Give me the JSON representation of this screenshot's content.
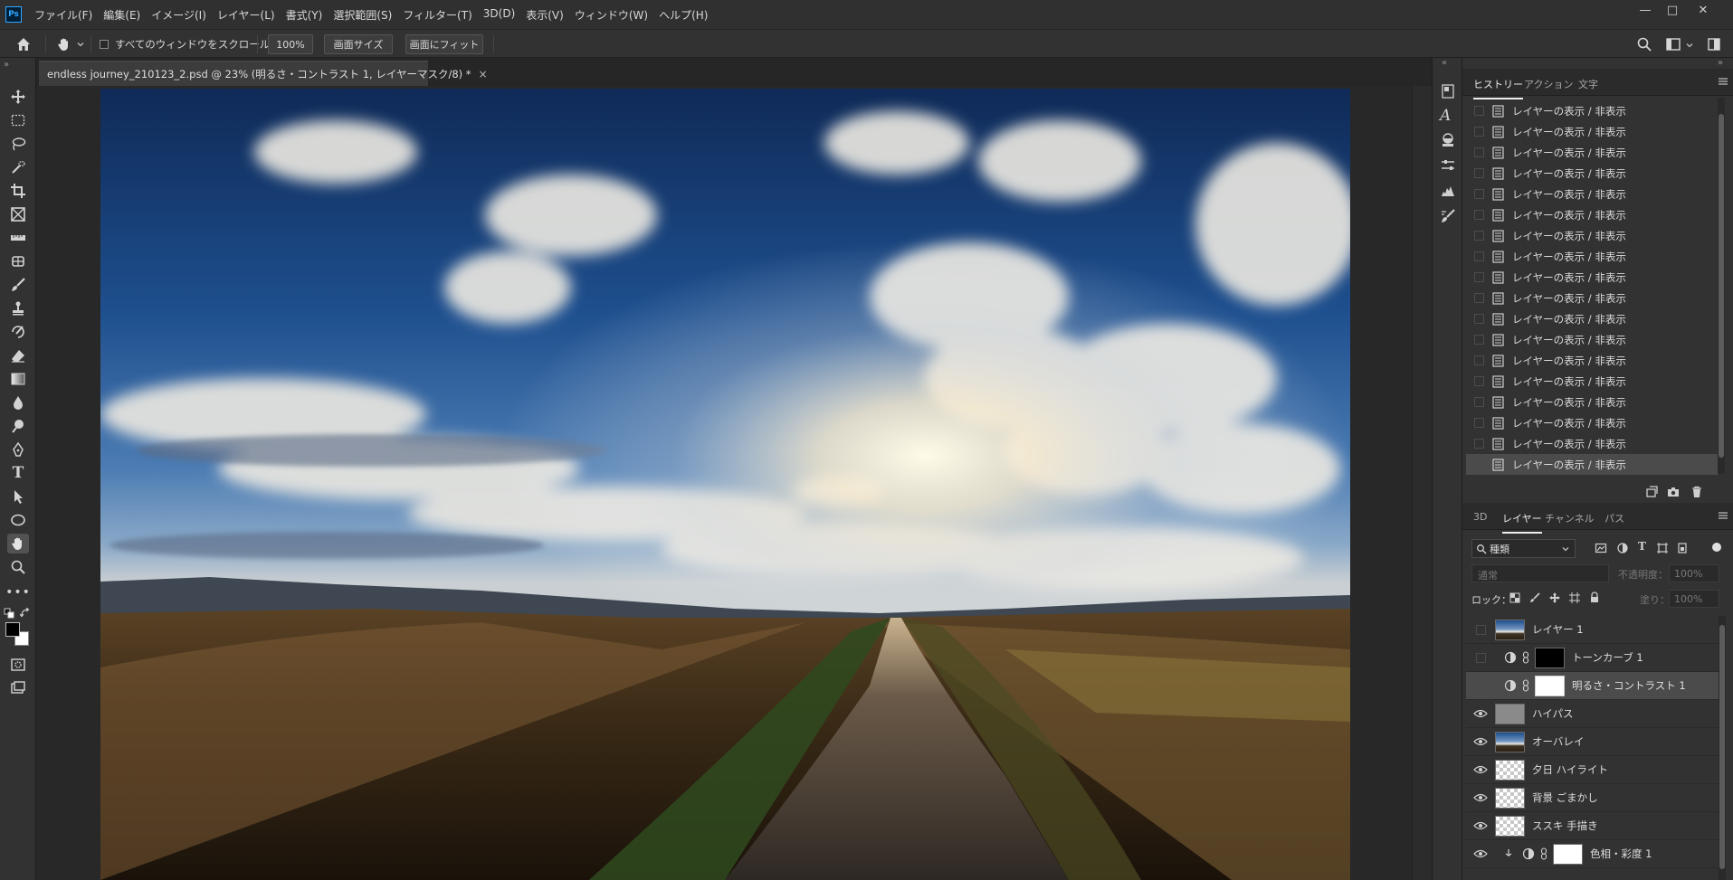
{
  "app": {
    "logo": "Ps"
  },
  "menu": [
    "ファイル(F)",
    "編集(E)",
    "イメージ(I)",
    "レイヤー(L)",
    "書式(Y)",
    "選択範囲(S)",
    "フィルター(T)",
    "3D(D)",
    "表示(V)",
    "ウィンドウ(W)",
    "ヘルプ(H)"
  ],
  "window_controls": {
    "minimize": "—",
    "maximize": "□",
    "close": "✕"
  },
  "options": {
    "scroll_all_label": "すべてのウィンドウをスクロール",
    "zoom_value": "100%",
    "fit_screen_size": "画面サイズ",
    "fit_screen": "画面にフィット"
  },
  "document": {
    "tab_title": "endless journey_210123_2.psd @ 23% (明るさ・コントラスト 1, レイヤーマスク/8) *",
    "close_glyph": "×"
  },
  "history_panel": {
    "tabs": [
      "ヒストリー",
      "アクション",
      "文字"
    ],
    "active_tab": 0,
    "items": [
      "レイヤーの表示 / 非表示",
      "レイヤーの表示 / 非表示",
      "レイヤーの表示 / 非表示",
      "レイヤーの表示 / 非表示",
      "レイヤーの表示 / 非表示",
      "レイヤーの表示 / 非表示",
      "レイヤーの表示 / 非表示",
      "レイヤーの表示 / 非表示",
      "レイヤーの表示 / 非表示",
      "レイヤーの表示 / 非表示",
      "レイヤーの表示 / 非表示",
      "レイヤーの表示 / 非表示",
      "レイヤーの表示 / 非表示",
      "レイヤーの表示 / 非表示",
      "レイヤーの表示 / 非表示",
      "レイヤーの表示 / 非表示",
      "レイヤーの表示 / 非表示",
      "レイヤーの表示 / 非表示"
    ]
  },
  "layers_panel": {
    "tabs": [
      "3D",
      "レイヤー",
      "チャンネル",
      "パス"
    ],
    "active_tab": 1,
    "filter_kind": "種類",
    "blend_mode": "通常",
    "opacity_label": "不透明度：",
    "opacity_value": "100%",
    "lock_label": "ロック：",
    "fill_label": "塗り：",
    "fill_value": "100%",
    "layers": [
      {
        "name": "レイヤー 1",
        "visible": false,
        "thumb": "photo",
        "adjustment": false,
        "mask": null
      },
      {
        "name": "トーンカーブ 1",
        "visible": false,
        "thumb": null,
        "adjustment": true,
        "mask": "black"
      },
      {
        "name": "明るさ・コントラスト 1",
        "visible": false,
        "thumb": null,
        "adjustment": true,
        "mask": "white",
        "selected": true
      },
      {
        "name": "ハイパス",
        "visible": true,
        "thumb": "gray",
        "adjustment": false,
        "mask": null
      },
      {
        "name": "オーバレイ",
        "visible": true,
        "thumb": "photo",
        "adjustment": false,
        "mask": null
      },
      {
        "name": "夕日 ハイライト",
        "visible": true,
        "thumb": "checker",
        "adjustment": false,
        "mask": null
      },
      {
        "name": "背景 ごまかし",
        "visible": true,
        "thumb": "checker",
        "adjustment": false,
        "mask": null
      },
      {
        "name": "ススキ 手描き",
        "visible": true,
        "thumb": "checker",
        "adjustment": false,
        "mask": null
      },
      {
        "name": "色相・彩度 1",
        "visible": true,
        "thumb": null,
        "adjustment": true,
        "mask": "white",
        "clipped": true
      }
    ]
  },
  "colors": {
    "accent": "#31a8ff",
    "panel_bg": "#323232",
    "canvas_bg": "#282828",
    "selection": "#4b4b4b"
  }
}
